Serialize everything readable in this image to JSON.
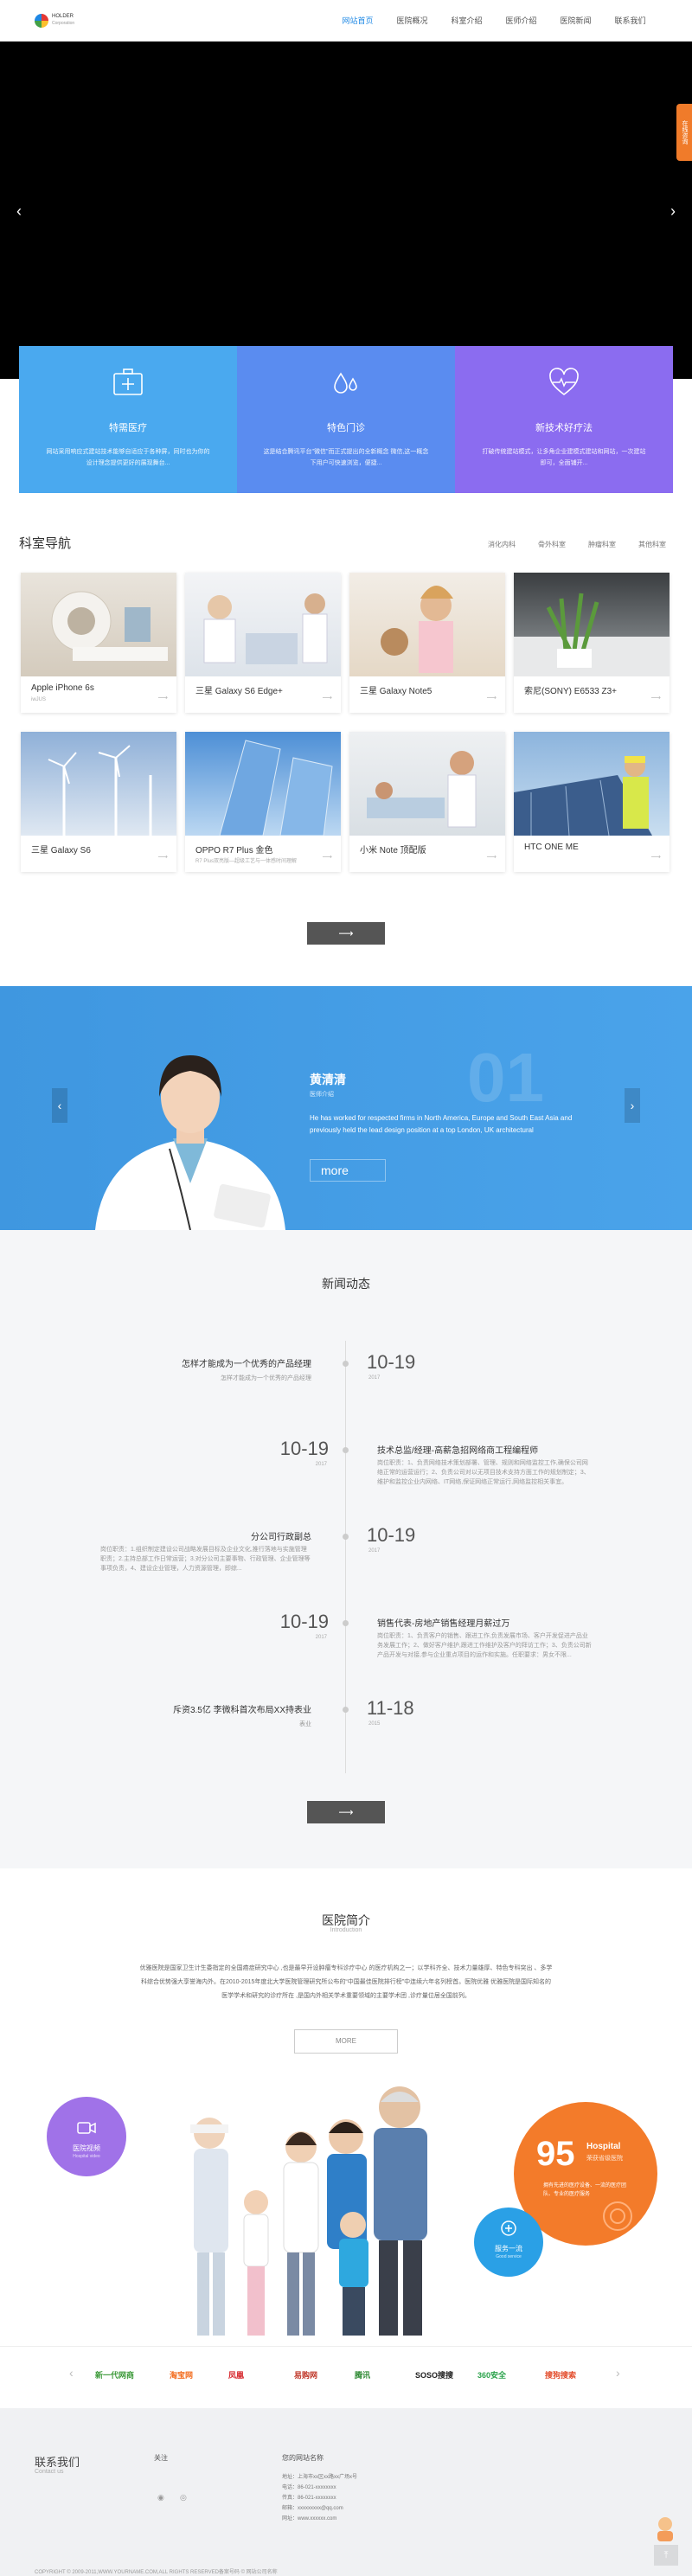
{
  "header": {
    "logo_line1": "HOLDER",
    "logo_line2": "Corporation",
    "nav": [
      "网站首页",
      "医院概况",
      "科室介绍",
      "医师介绍",
      "医院新闻",
      "联系我们"
    ]
  },
  "side_tab": "在线咨询",
  "features": [
    {
      "title": "特需医疗",
      "desc": "网站采用响应式建站技术能够自适应于各种屏，同时也为你的设计理念提供更好的展现舞台..."
    },
    {
      "title": "特色门诊",
      "desc": "这是结合腾讯平台\"微信\"而正式提出的全新概念 微信,这一概念下用户可快速浏览，便捷..."
    },
    {
      "title": "新技术好疗法",
      "desc": "打破传统建站模式，让多角企业建模式建站和网站，一次建站即可，全面铺开..."
    }
  ],
  "department": {
    "title": "科室导航",
    "tabs": [
      "消化内科",
      "骨外科室",
      "肿瘤科室",
      "其他科室"
    ],
    "cards": [
      {
        "name": "Apple iPhone 6s",
        "sub": "iwJUS"
      },
      {
        "name": "三星 Galaxy S6 Edge+",
        "sub": ""
      },
      {
        "name": "三星 Galaxy Note5",
        "sub": ""
      },
      {
        "name": "索尼(SONY) E6533 Z3+",
        "sub": ""
      },
      {
        "name": "三星 Galaxy S6",
        "sub": ""
      },
      {
        "name": "OPPO R7 Plus 金色",
        "sub": "R7 Plus双亮版—超级工艺与一体感时间理解"
      },
      {
        "name": "小米 Note 顶配版",
        "sub": ""
      },
      {
        "name": "HTC ONE ME",
        "sub": ""
      }
    ],
    "more": "⟶"
  },
  "doctor": {
    "name": "黄清清",
    "role": "医师介绍",
    "desc": "He has worked for respected firms in North America, Europe and South East Asia and previously held the lead design position at a top London, UK architectural",
    "num": "01",
    "more": "more"
  },
  "news": {
    "title": "新闻动态",
    "items": [
      {
        "title": "怎样才能成为一个优秀的产品经理",
        "desc": "怎样才能成为一个优秀的产品经理",
        "date": "10-19",
        "year": "2017"
      },
      {
        "title": "技术总监/经理-高薪急招网络商工程编程师",
        "desc": "岗位职责：1、负责网络技术策划部署、管理、规则和网络监控工作,确保公司网络正常的运营运行；2、负责公司对以无项目技术支持方面工作的规划制定；3、维护和监控企业内网络、IT网络,保证网络正常运行,网络监控相关事宜。",
        "date": "10-19",
        "year": "2017"
      },
      {
        "title": "分公司行政副总",
        "desc": "岗位职责：1.组织制定建设公司战略发展目标及企业文化,推行落地与实施管理职责；2.主持总部工作日常运营；3.对分公司主要事物、行政管理、企业管理等事项负责，4、建设企业管理，人力资源管理，即综...",
        "date": "10-19",
        "year": "2017"
      },
      {
        "title": "销售代表-房地产销售经理月薪过万",
        "desc": "岗位职责：1、负责客户的销售、跟进工作,负责发展市场、客户开发促进产品业务发展工作；2、做好客户维护,跟进工作维护及客户的拜访工作；3、负责公司新产品开发与对接,参与企业重点项目的运作和实施。任职要求：男女不限...",
        "date": "10-19",
        "year": "2017"
      },
      {
        "title": "斥资3.5亿 李微科首次布局XX持表业",
        "desc": "表业",
        "date": "11-18",
        "year": "2015"
      }
    ],
    "more": "⟶"
  },
  "intro": {
    "title": "医院简介",
    "subtitle": "Introduction",
    "text": "优雅医院是国家卫生计生委指定的全国癌症研究中心 ,也是最早开设肿瘤专科诊疗中心 的医疗机构之一；以学科齐全、技术力量雄厚、特色专科突出 、多学科综合优势强大享誉海内外。在2010-2015年度北大学医院管理研究所公布的“中国最佳医院排行榜”中连续六年名列榜首。医院优雅  优雅医院是国际知名的医学学术和研究的诊疗所在 ,是国内外相关学术重要领域的主要学术团 ,诊疗量位居全国前列。",
    "more": "MORE",
    "badge_left_title": "医院视频",
    "badge_left_sub": "Hospital video",
    "badge_number": "95",
    "badge_hospital": "Hospital",
    "badge_right_sub": "荣获省级医院",
    "badge_right_text": "拥有先进的医疗设备、一流的医疗团队、专业的医疗服务",
    "badge_blue_title": "服务一流",
    "badge_blue_sub": "Good service"
  },
  "partners": [
    "新一代网商",
    "淘宝网",
    "凤凰",
    "易购网",
    "腾讯",
    "SOSO搜搜",
    "360安全",
    "搜狗搜索"
  ],
  "footer": {
    "contact_title": "联系我们",
    "contact_sub": "Contact us",
    "follow_title": "关注",
    "site_title": "您的网站名称",
    "lines": [
      "地址：上海市xx区xx路xx广场x号",
      "电话：86-021-xxxxxxxx",
      "传真：86-021-xxxxxxxx",
      "邮箱：xxxxxxxxx@qq.com",
      "网址：www.xxxxxx.com"
    ],
    "copyright": "COPYRIGHT © 2009-2011,WWW.YOURNAME.COM,ALL RIGHTS RESERVED备案号码 © 网站公司名称"
  },
  "colors": {
    "feature1": "#4aa9ef",
    "feature2": "#5a8cf0",
    "feature3": "#8b6cf0",
    "doctor": "#4aa3ea",
    "accent_orange": "#f37b2a"
  }
}
